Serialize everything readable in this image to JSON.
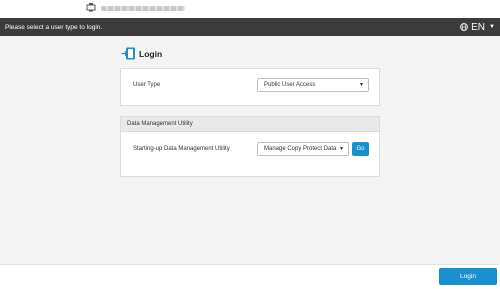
{
  "header": {
    "instruction": "Please select a user type to login.",
    "language": "EN",
    "icons": {
      "device": "mfp-device-icon",
      "globe": "globe-icon",
      "caret": "caret-down-icon"
    }
  },
  "login_section": {
    "title": "Login",
    "icon": "login-door-icon",
    "user_type": {
      "label": "User Type",
      "selected": "Public User Access"
    }
  },
  "data_management": {
    "header": "Data Management Utility",
    "startup_label": "Starting-up Data Management Utility",
    "selected": "Manage Copy Protect Data",
    "go_label": "Go"
  },
  "footer": {
    "login_button": "Login"
  },
  "colors": {
    "accent": "#1a8fce",
    "topbar": "#3b3b3b",
    "background": "#f3f3f3"
  }
}
